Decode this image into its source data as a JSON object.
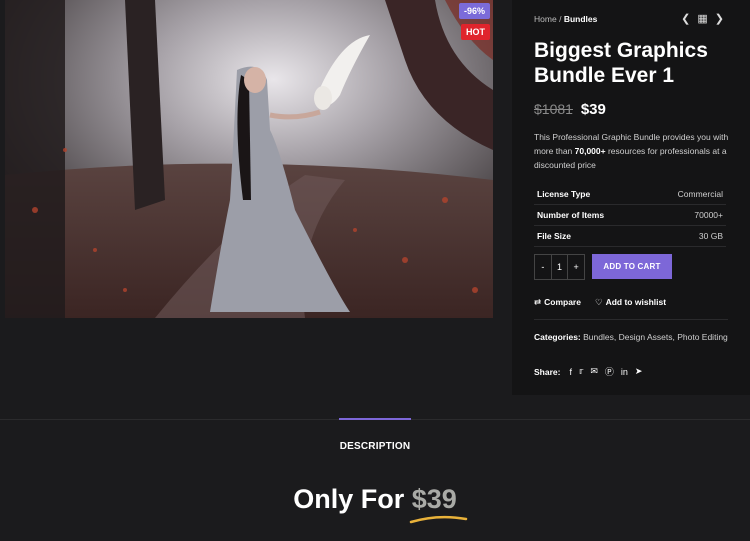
{
  "product": {
    "discount_badge": "-96%",
    "hot_badge": "HOT",
    "image_description": "woman in grey gown in a forest with a white owl"
  },
  "breadcrumb": {
    "home": "Home",
    "separator": "/",
    "current": "Bundles"
  },
  "nav_icons": {
    "prev": "chevron-left-icon",
    "grid": "grid-icon",
    "next": "chevron-right-icon"
  },
  "title": "Biggest Graphics Bundle Ever 1",
  "price": {
    "old": "$1081",
    "new": "$39"
  },
  "description": {
    "before": "This Professional Graphic Bundle provides you with more than ",
    "highlight": "70,000+",
    "after": " resources for professionals at a discounted price"
  },
  "specs": [
    {
      "label": "License Type",
      "value": "Commercial"
    },
    {
      "label": "Number of Items",
      "value": "70000+"
    },
    {
      "label": "File Size",
      "value": "30 GB"
    }
  ],
  "quantity": {
    "minus": "-",
    "value": "1",
    "plus": "+"
  },
  "add_to_cart": "ADD TO CART",
  "actions": {
    "compare": "Compare",
    "wishlist": "Add to wishlist"
  },
  "categories": {
    "label": "Categories:",
    "items": [
      "Bundles",
      "Design Assets",
      "Photo Editing"
    ]
  },
  "share": {
    "label": "Share:",
    "icons": [
      "facebook-icon",
      "twitter-icon",
      "email-icon",
      "pinterest-icon",
      "linkedin-icon",
      "telegram-icon"
    ]
  },
  "tabs": {
    "description": "DESCRIPTION"
  },
  "promo": {
    "prefix": "Only For",
    "amount": "$39"
  },
  "colors": {
    "accent": "#7d67d8",
    "hot": "#e0242c",
    "background": "#1b1b1d",
    "panel": "#141415"
  }
}
